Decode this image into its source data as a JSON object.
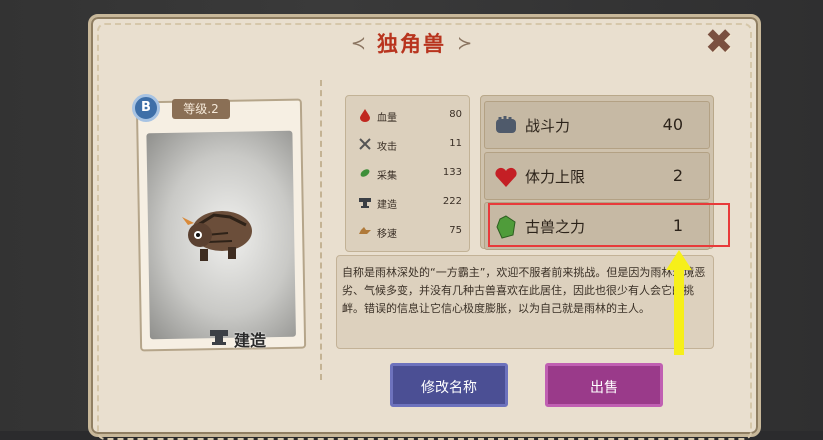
{
  "title": "独角兽",
  "title_ornament_left": "≺",
  "title_ornament_right": "≻",
  "close_icon_glyph": "✖",
  "card": {
    "rank": "B",
    "level": "等级.2",
    "skill": "建造"
  },
  "stats": [
    {
      "icon": "blood-drop-icon",
      "name": "血量",
      "value": "80"
    },
    {
      "icon": "crossed-swords-icon",
      "name": "攻击",
      "value": "11"
    },
    {
      "icon": "leaf-gather-icon",
      "name": "采集",
      "value": "133"
    },
    {
      "icon": "anvil-build-icon",
      "name": "建造",
      "value": "222"
    },
    {
      "icon": "wing-boot-speed-icon",
      "name": "移速",
      "value": "75"
    }
  ],
  "powers": [
    {
      "icon": "fist-icon",
      "name": "战斗力",
      "value": "40"
    },
    {
      "icon": "heart-icon",
      "name": "体力上限",
      "value": "2"
    },
    {
      "icon": "green-crystal-icon",
      "name": "古兽之力",
      "value": "1"
    }
  ],
  "description": "自称是雨林深处的“一方霸主”，欢迎不服者前来挑战。但是因为雨林环境恶劣、气候多变，并没有几种古兽喜欢在此居住，因此也很少有人会它的挑衅。错误的信息让它信心极度膨胀，以为自己就是雨林的主人。",
  "buttons": {
    "rename": "修改名称",
    "sell": "出售"
  },
  "colors": {
    "title": "#b8341e",
    "rename_button": "#4b4f94",
    "sell_button": "#9a3a8a",
    "highlight_box": "#e83a3a",
    "arrow": "#f6ef1a"
  }
}
